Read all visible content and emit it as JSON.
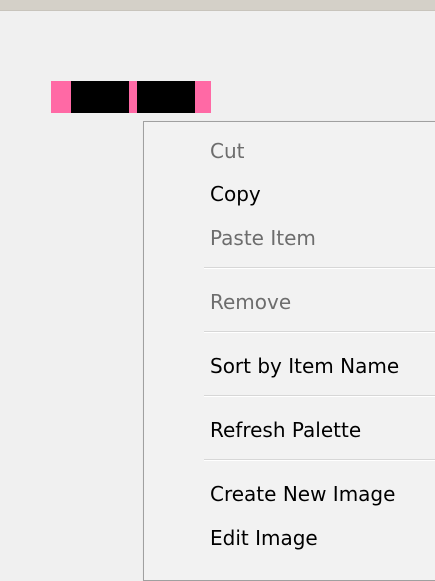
{
  "palette": {
    "item_color": "#ff69a5",
    "swatch_color": "#000000"
  },
  "context_menu": {
    "items": [
      {
        "label": "Cut",
        "enabled": false
      },
      {
        "label": "Copy",
        "enabled": true
      },
      {
        "label": "Paste Item",
        "enabled": false
      },
      {
        "label": "Remove",
        "enabled": false
      },
      {
        "label": "Sort by Item Name",
        "enabled": true
      },
      {
        "label": "Refresh Palette",
        "enabled": true
      },
      {
        "label": "Create New Image",
        "enabled": true
      },
      {
        "label": "Edit Image",
        "enabled": true
      }
    ]
  }
}
